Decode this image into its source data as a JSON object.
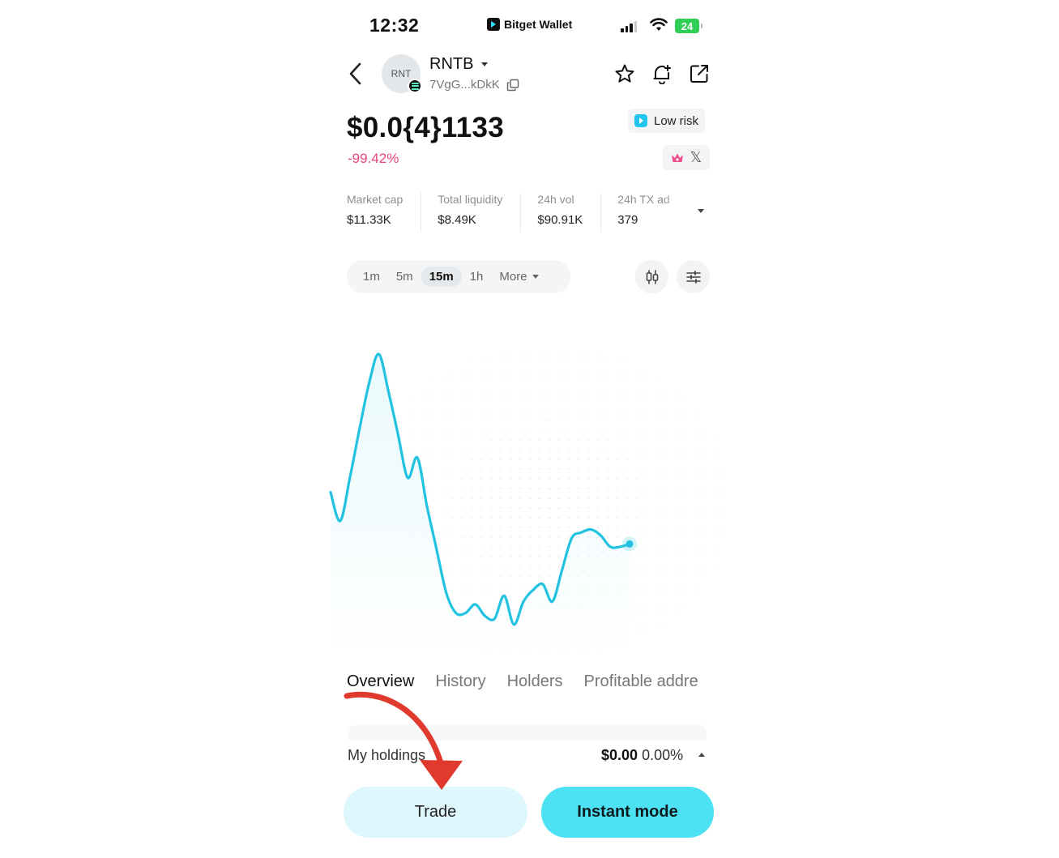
{
  "status": {
    "time": "12:32",
    "app_name": "Bitget Wallet",
    "battery": "24"
  },
  "header": {
    "avatar_text": "RNT",
    "token_symbol": "RNTB",
    "token_address": "7VgG...kDkK"
  },
  "price": {
    "value": "$0.0{4}1133",
    "change": "-99.42%",
    "risk_label": "Low risk",
    "colors": {
      "negative": "#e8457a",
      "accent": "#20c6f0"
    }
  },
  "stats": [
    {
      "label": "Market cap",
      "value": "$11.33K"
    },
    {
      "label": "Total liquidity",
      "value": "$8.49K"
    },
    {
      "label": "24h vol",
      "value": "$90.91K"
    },
    {
      "label": "24h TX ad",
      "value": "379"
    }
  ],
  "timeframes": {
    "items": [
      "1m",
      "5m",
      "15m",
      "1h",
      "More"
    ],
    "selected": "15m"
  },
  "chart_data": {
    "type": "line",
    "series": [
      {
        "values": [
          0.5,
          0.4,
          0.55,
          0.72,
          0.88,
          0.98,
          0.85,
          0.7,
          0.55,
          0.62,
          0.45,
          0.3,
          0.15,
          0.08,
          0.08,
          0.11,
          0.07,
          0.06,
          0.14,
          0.04,
          0.12,
          0.16,
          0.18,
          0.12,
          0.23,
          0.34,
          0.36,
          0.37,
          0.35,
          0.31,
          0.31,
          0.32
        ]
      }
    ],
    "color": "#22c3e0"
  },
  "tabs": {
    "items": [
      "Overview",
      "History",
      "Holders",
      "Profitable addre"
    ],
    "selected": "Overview"
  },
  "holdings": {
    "label": "My holdings",
    "value": "$0.00",
    "percent": "0.00%"
  },
  "actions": {
    "trade_label": "Trade",
    "instant_label": "Instant mode"
  },
  "annotation": {
    "arrow_color": "#e03a2e"
  }
}
